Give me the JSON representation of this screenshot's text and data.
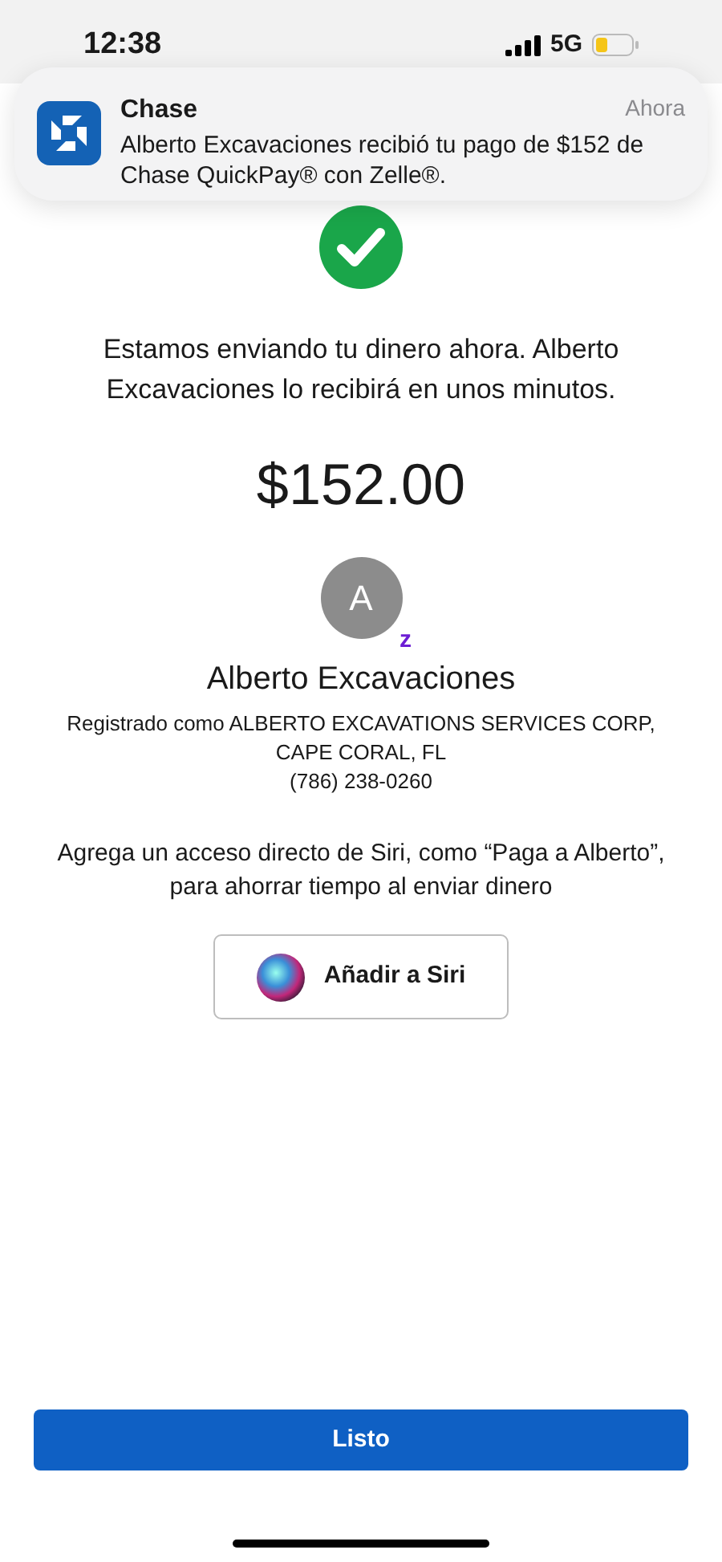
{
  "status_bar": {
    "time": "12:38",
    "network": "5G"
  },
  "notification": {
    "app": "Chase",
    "time": "Ahora",
    "message": "Alberto Excavaciones recibió tu pago de $152 de Chase QuickPay® con Zelle®."
  },
  "confirmation": {
    "message": "Estamos enviando tu dinero ahora. Alberto Excavaciones lo recibirá en unos minutos.",
    "amount": "$152.00"
  },
  "recipient": {
    "initial": "A",
    "badge": "z",
    "name": "Alberto Excavaciones",
    "details": [
      "Registrado como ALBERTO EXCAVATIONS SERVICES CORP,",
      "CAPE CORAL, FL",
      "(786) 238-0260"
    ]
  },
  "siri": {
    "hint": "Agrega un acceso directo de Siri, como “Paga a Alberto”, para ahorrar tiempo al enviar dinero",
    "button": "Añadir a Siri"
  },
  "done_button": "Listo"
}
